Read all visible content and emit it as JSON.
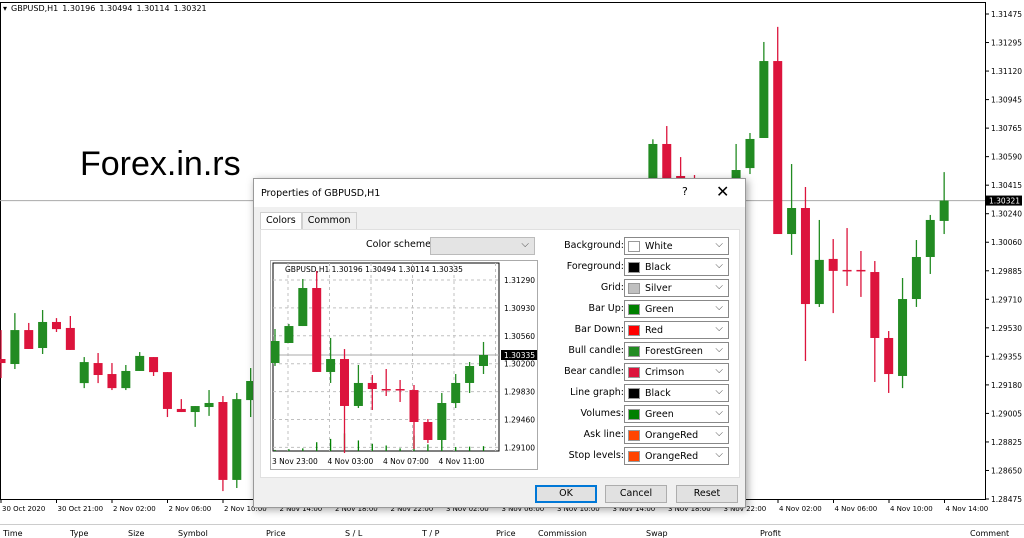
{
  "chart": {
    "symbol": "GBPUSD,H1",
    "ohlc": [
      "1.30196",
      "1.30494",
      "1.30114",
      "1.30321"
    ],
    "watermark": "Forex.in.rs",
    "current_price": "1.30321",
    "price_labels": [
      "1.31475",
      "1.31295",
      "1.31120",
      "1.30945",
      "1.30765",
      "1.30590",
      "1.30415",
      "1.30240",
      "1.30060",
      "1.29885",
      "1.29710",
      "1.29530",
      "1.29355",
      "1.29180",
      "1.29005",
      "1.28825",
      "1.28650",
      "1.28475"
    ],
    "time_labels": [
      "30 Oct 2020",
      "30 Oct 21:00",
      "2 Nov 02:00",
      "2 Nov 06:00",
      "2 Nov 10:00",
      "2 Nov 14:00",
      "2 Nov 18:00",
      "2 Nov 22:00",
      "3 Nov 02:00",
      "3 Nov 06:00",
      "3 Nov 10:00",
      "3 Nov 14:00",
      "3 Nov 18:00",
      "3 Nov 22:00",
      "4 Nov 02:00",
      "4 Nov 06:00",
      "4 Nov 10:00",
      "4 Nov 14:00"
    ],
    "bull_color": "#228b22",
    "bear_color": "#dc143c",
    "candles": [
      [
        1.29341,
        1.2952,
        1.29223,
        1.29316
      ],
      [
        1.2931,
        1.29625,
        1.29279,
        1.2952
      ],
      [
        1.2952,
        1.29564,
        1.29403,
        1.29403
      ],
      [
        1.29409,
        1.29644,
        1.29372,
        1.2957
      ],
      [
        1.2957,
        1.29594,
        1.29508,
        1.29526
      ],
      [
        1.29533,
        1.29607,
        1.29397,
        1.29397
      ],
      [
        1.29192,
        1.29353,
        1.29161,
        1.29322
      ],
      [
        1.29316,
        1.29378,
        1.29192,
        1.29242
      ],
      [
        1.29248,
        1.29316,
        1.29149,
        1.29161
      ],
      [
        1.29161,
        1.29304,
        1.29149,
        1.29267
      ],
      [
        1.29267,
        1.29384,
        1.29267,
        1.2936
      ],
      [
        1.29353,
        1.29353,
        1.29236,
        1.2926
      ],
      [
        1.2926,
        1.2926,
        1.28982,
        1.29032
      ],
      [
        1.29032,
        1.29093,
        1.29013,
        1.29013
      ],
      [
        1.29013,
        1.2905,
        1.28921,
        1.2905
      ],
      [
        1.29044,
        1.29149,
        1.28989,
        1.29069
      ],
      [
        1.29075,
        1.29112,
        1.28524,
        1.28593
      ],
      [
        1.28593,
        1.29131,
        1.28543,
        1.29093
      ],
      [
        1.29087,
        1.29285,
        1.28982,
        1.29205
      ],
      null,
      null,
      null,
      null,
      null,
      null,
      null,
      null,
      null,
      null,
      null,
      null,
      null,
      null,
      null,
      null,
      null,
      null,
      null,
      null,
      null,
      null,
      null,
      null,
      null,
      null,
      null,
      null,
      [
        1.304,
        1.307,
        1.3035,
        1.30671
      ],
      [
        1.30671,
        1.30782,
        1.3038,
        1.304
      ],
      [
        1.30473,
        1.3059,
        1.304,
        1.3043
      ],
      [
        1.304,
        1.30479,
        1.3035,
        1.3038
      ],
      null,
      null,
      [
        1.304,
        1.30671,
        1.3035,
        1.3051
      ],
      [
        1.30522,
        1.30739,
        1.30485,
        1.30702
      ],
      [
        1.30708,
        1.31302,
        1.30708,
        1.31184
      ],
      [
        1.31184,
        1.31395,
        1.30114,
        1.30114
      ],
      [
        1.30114,
        1.30547,
        1.29985,
        1.30275
      ],
      [
        1.30275,
        1.30405,
        1.29329,
        1.29681
      ],
      [
        1.29681,
        1.30201,
        1.29663,
        1.29954
      ],
      [
        1.2996,
        1.30083,
        1.29625,
        1.29886
      ],
      [
        1.29892,
        1.30151,
        1.29793,
        1.29886
      ],
      [
        1.29892,
        1.30009,
        1.29725,
        1.29886
      ],
      [
        1.29879,
        1.29947,
        1.29199,
        1.29471
      ],
      [
        1.29471,
        1.29514,
        1.29131,
        1.29248
      ],
      [
        1.29236,
        1.29842,
        1.29161,
        1.29712
      ],
      [
        1.29712,
        1.30077,
        1.29663,
        1.29972
      ],
      [
        1.29972,
        1.30232,
        1.29867,
        1.30201
      ],
      [
        1.30195,
        1.30497,
        1.30114,
        1.30321
      ]
    ]
  },
  "terminal": {
    "columns": [
      "Time",
      "Type",
      "Size",
      "Symbol",
      "Price",
      "S / L",
      "T / P",
      "Price",
      "Commission",
      "Swap",
      "Profit",
      "Comment"
    ]
  },
  "dialog": {
    "title": "Properties of GBPUSD,H1",
    "help": "?",
    "close": "✕",
    "tabs": [
      "Colors",
      "Common"
    ],
    "color_scheme_label": "Color scheme:",
    "color_scheme_value": "",
    "preview": {
      "header": "GBPUSD,H1  1.30196 1.30494 1.30114 1.30335",
      "current_price": "1.30335",
      "price_labels": [
        "1.31290",
        "1.30930",
        "1.30560",
        "1.30200",
        "1.29830",
        "1.29460",
        "1.29100"
      ],
      "time_labels": [
        "3 Nov 23:00",
        "4 Nov 03:00",
        "4 Nov 07:00",
        "4 Nov 11:00"
      ],
      "candles": [
        [
          1.30233,
          1.30666,
          1.30195,
          1.30513
        ],
        [
          1.30488,
          1.3073,
          1.30488,
          1.30704
        ],
        [
          1.30704,
          1.31303,
          1.30704,
          1.31188
        ],
        [
          1.31188,
          1.31405,
          1.30119,
          1.30119
        ],
        [
          1.30119,
          1.30552,
          1.29979,
          1.30284
        ],
        [
          1.30284,
          1.30411,
          1.29087,
          1.29686
        ],
        [
          1.29686,
          1.30208,
          1.2966,
          1.29979
        ],
        [
          1.29979,
          1.3008,
          1.29635,
          1.29902
        ],
        [
          1.29902,
          1.30157,
          1.29813,
          1.29889
        ],
        [
          1.29902,
          1.30017,
          1.29737,
          1.29889
        ],
        [
          1.29889,
          1.29953,
          1.29138,
          1.29482
        ],
        [
          1.29482,
          1.2952,
          1.29215,
          1.29253
        ],
        [
          1.29253,
          1.29851,
          1.29215,
          1.29724
        ],
        [
          1.29724,
          1.30093,
          1.2966,
          1.29979
        ],
        [
          1.29979,
          1.30246,
          1.29851,
          1.30195
        ],
        [
          1.30195,
          1.30501,
          1.30093,
          1.30335
        ]
      ],
      "volumes": [
        5,
        8,
        12,
        40,
        55,
        80,
        48,
        33,
        25,
        12,
        70,
        30,
        60,
        18,
        20,
        22
      ]
    },
    "properties": [
      {
        "label": "Background:",
        "value": "White",
        "color": "#ffffff"
      },
      {
        "label": "Foreground:",
        "value": "Black",
        "color": "#000000"
      },
      {
        "label": "Grid:",
        "value": "Silver",
        "color": "#c0c0c0"
      },
      {
        "label": "Bar Up:",
        "value": "Green",
        "color": "#008000"
      },
      {
        "label": "Bar Down:",
        "value": "Red",
        "color": "#ff0000"
      },
      {
        "label": "Bull candle:",
        "value": "ForestGreen",
        "color": "#228b22"
      },
      {
        "label": "Bear candle:",
        "value": "Crimson",
        "color": "#dc143c"
      },
      {
        "label": "Line graph:",
        "value": "Black",
        "color": "#000000"
      },
      {
        "label": "Volumes:",
        "value": "Green",
        "color": "#008000"
      },
      {
        "label": "Ask line:",
        "value": "OrangeRed",
        "color": "#ff4500"
      },
      {
        "label": "Stop levels:",
        "value": "OrangeRed",
        "color": "#ff4500"
      }
    ],
    "buttons": {
      "ok": "OK",
      "cancel": "Cancel",
      "reset": "Reset"
    }
  }
}
